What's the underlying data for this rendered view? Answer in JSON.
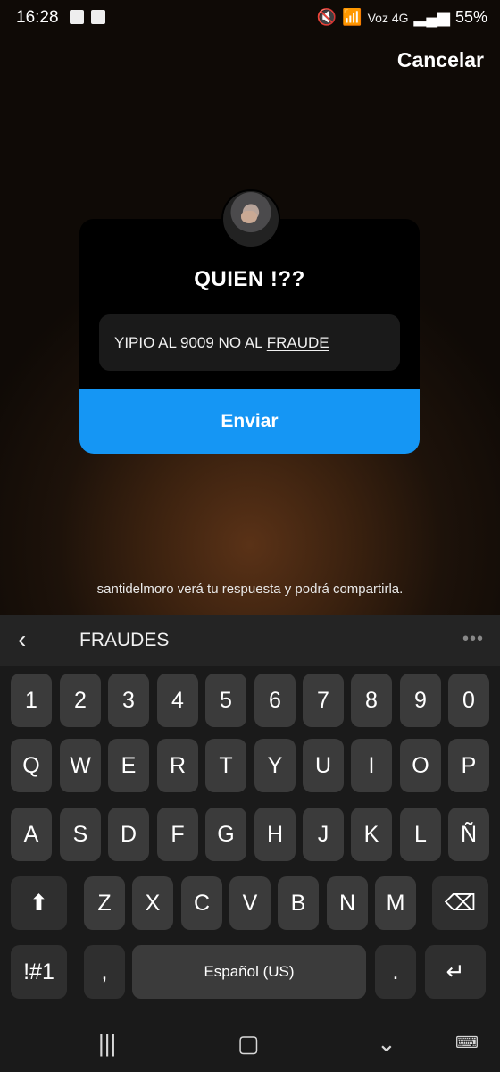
{
  "status": {
    "time": "16:28",
    "signal_text": "Voz 4G",
    "battery": "55%"
  },
  "header": {
    "cancel_label": "Cancelar"
  },
  "card": {
    "question": "QUIEN !??",
    "answer_prefix": "YIPIO AL 9009 NO AL ",
    "answer_underlined": "FRAUDE",
    "send_label": "Enviar"
  },
  "notice": "santidelmoro verá tu respuesta y podrá compartirla.",
  "keyboard": {
    "suggestion": "FRAUDES",
    "row_numbers": [
      "1",
      "2",
      "3",
      "4",
      "5",
      "6",
      "7",
      "8",
      "9",
      "0"
    ],
    "row1": [
      "Q",
      "W",
      "E",
      "R",
      "T",
      "Y",
      "U",
      "I",
      "O",
      "P"
    ],
    "row2": [
      "A",
      "S",
      "D",
      "F",
      "G",
      "H",
      "J",
      "K",
      "L",
      "Ñ"
    ],
    "row3": [
      "Z",
      "X",
      "C",
      "V",
      "B",
      "N",
      "M"
    ],
    "symbols_label": "!#1",
    "comma_label": ",",
    "space_label": "Español (US)",
    "period_label": "."
  }
}
